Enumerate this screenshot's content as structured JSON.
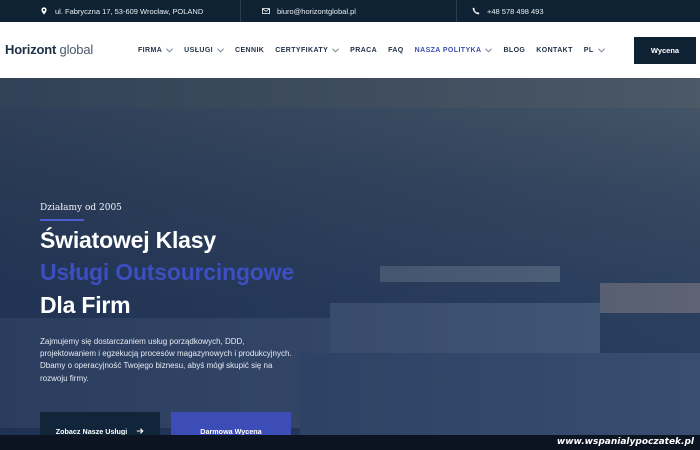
{
  "topbar": {
    "address": "ul. Fabryczna 17, 53-609 Wrocław, POLAND",
    "email": "biuro@horizontglobal.pl",
    "phone": "+48 578 498 493",
    "address_icon": "location-pin-icon",
    "email_icon": "envelope-icon",
    "phone_icon": "phone-icon"
  },
  "logo": {
    "bold": "Horizont",
    "light": " global"
  },
  "nav": {
    "items": [
      {
        "label": "FIRMA",
        "dropdown": true
      },
      {
        "label": "USŁUGI",
        "dropdown": true
      },
      {
        "label": "CENNIK",
        "dropdown": false
      },
      {
        "label": "CERTYFIKATY",
        "dropdown": true
      },
      {
        "label": "PRACA",
        "dropdown": false
      },
      {
        "label": "FAQ",
        "dropdown": false
      },
      {
        "label": "NASZA POLITYKA",
        "dropdown": true,
        "active": true
      },
      {
        "label": "BLOG",
        "dropdown": false
      },
      {
        "label": "KONTAKT",
        "dropdown": false
      },
      {
        "label": "PL",
        "dropdown": true
      }
    ],
    "quote_button": "Wycena"
  },
  "hero": {
    "eyebrow": "Działamy od 2005",
    "title_line1": "Światowej Klasy",
    "title_line2": "Usługi Outsourcingowe",
    "title_line3": "Dla Firm",
    "description": "Zajmujemy się dostarczaniem usług porządkowych, DDD, projektowaniem i egzekucją procesów magazynowych i produkcyjnych. Dbamy o operacyjność Twojego biznesu, abyś mógł skupić się na rozwoju firmy.",
    "primary_button": "Zobacz Nasze Usługi",
    "secondary_button": "Darmowa Wycena"
  },
  "watermark": "www.wspanialypoczatek.pl",
  "colors": {
    "navy": "#0f2233",
    "accent": "#3d4ec0",
    "white": "#ffffff"
  }
}
